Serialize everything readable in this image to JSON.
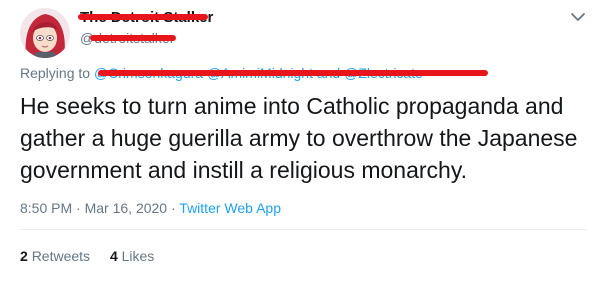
{
  "tweet": {
    "display_name": "The Detroit Stalker",
    "handle": "@detroitstalker",
    "reply_prefix": "Replying to",
    "reply_users": "@Crimsonkagura @AmimiMidnight and @Zlectricate",
    "text": "He seeks to turn anime into Catholic propaganda and gather a huge guerilla army to overthrow the Japanese government and instill a religious monarchy.",
    "time": "8:50 PM",
    "separator": "·",
    "date": "Mar 16, 2020",
    "source": "Twitter Web App",
    "retweets_count": "2",
    "retweets_label": "Retweets",
    "likes_count": "4",
    "likes_label": "Likes"
  },
  "colors": {
    "link": "#1da1f2",
    "secondary_text": "#657786",
    "redaction": "#e8151b",
    "avatar_hair": "#c3283a"
  },
  "icons": {
    "more": "chevron-down-icon"
  }
}
